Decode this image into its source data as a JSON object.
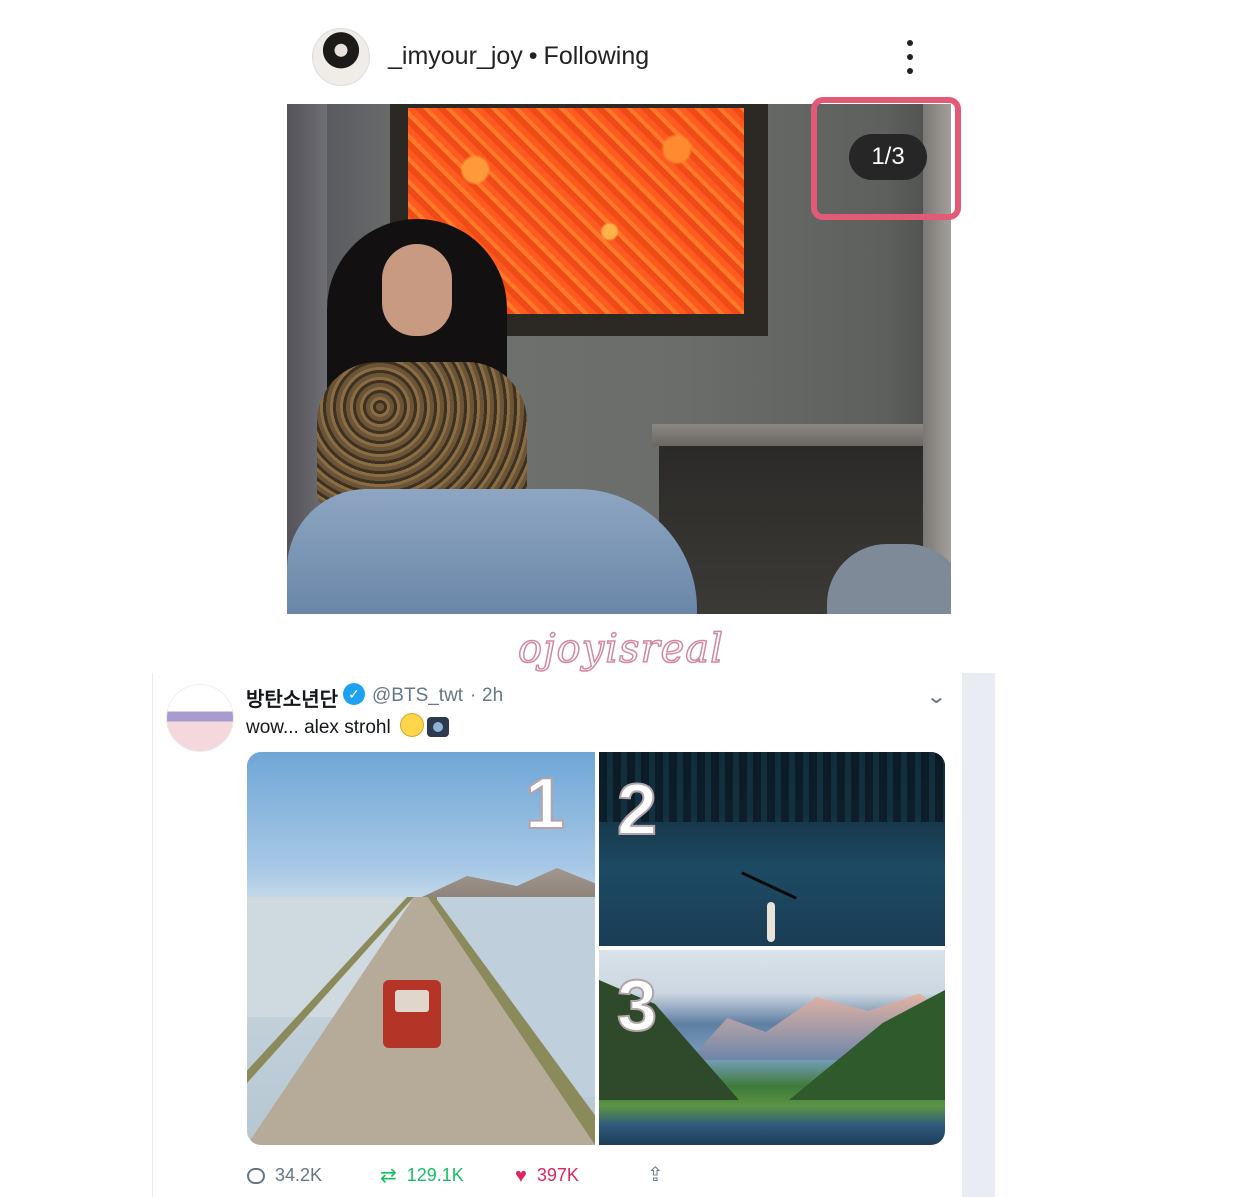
{
  "instagram": {
    "username": "_imyour_joy",
    "separator": "•",
    "follow_status": "Following",
    "image_counter": "1/3"
  },
  "watermark": "ojoyisreal",
  "tweet": {
    "display_name": "방탄소년단",
    "verified_mark": "✓",
    "handle": "@BTS_twt",
    "separator": "·",
    "time": "2h",
    "text": "wow... alex strohl",
    "media_labels": [
      "1",
      "2",
      "3"
    ],
    "reply_count": "34.2K",
    "retweet_count": "129.1K",
    "like_count": "397K"
  },
  "icons": {
    "more": "more-vertical-icon",
    "chevron": "chevron-down-icon",
    "reply": "reply-icon",
    "retweet": "retweet-icon",
    "like": "heart-icon",
    "share": "share-icon"
  },
  "colors": {
    "highlight_border": "#e35a76",
    "verified_blue": "#1da1f2",
    "retweet_green": "#17bf63",
    "like_red": "#e0245e",
    "meta_gray": "#657786"
  }
}
